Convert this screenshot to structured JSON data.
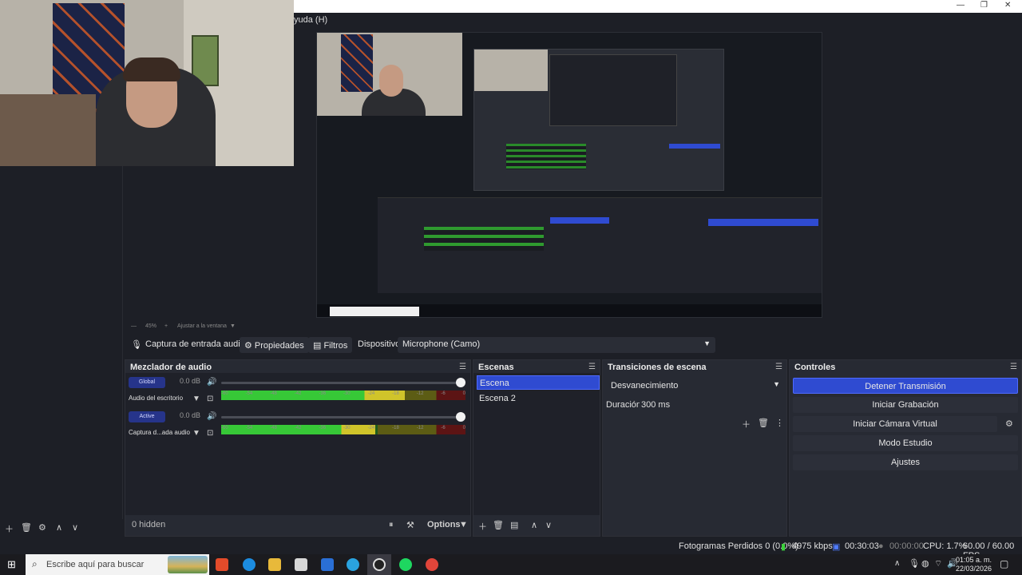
{
  "menubar": {
    "help_fragment": "yuda (H)"
  },
  "zoom": {
    "percent": "45%",
    "fit_label": "Ajustar a la ventana"
  },
  "source_toolbar": {
    "source_name": "Captura de entrada audio",
    "properties": "Propiedades",
    "filters": "Filtros",
    "device_label": "Dispositivo",
    "device_value": "Microphone (Camo)"
  },
  "mixer": {
    "title": "Mezclador de audio",
    "channels": [
      {
        "pill": "Global",
        "db": "0.0 dB",
        "name": "Audio del escritorio",
        "level": 0.75
      },
      {
        "pill": "Active",
        "db": "0.0 dB",
        "name": "Captura d...ada audio",
        "level": 0.63
      }
    ],
    "ticks": [
      "-60",
      "-54",
      "-48",
      "-42",
      "-36",
      "-30",
      "-24",
      "-18",
      "-12",
      "-6",
      "0"
    ]
  },
  "scenes": {
    "title": "Escenas",
    "items": [
      "Escena",
      "Escena 2"
    ],
    "selected": 0
  },
  "transitions": {
    "title": "Transiciones de escena",
    "selected": "Desvanecimiento",
    "duration_label": "Duración",
    "duration_value": "300 ms"
  },
  "controls": {
    "title": "Controles",
    "buttons": [
      "Detener Transmisión",
      "Iniciar Grabación",
      "Iniciar Cámara Virtual",
      "Modo Estudio",
      "Ajustes"
    ]
  },
  "sources_footer": {
    "hidden": "0 hidden",
    "options": "Options"
  },
  "status": {
    "dropped": "Fotogramas Perdidos 0 (0.0%)",
    "bitrate": "4975 kbps",
    "stream_time": "00:30:03",
    "rec_time": "00:00:00",
    "cpu": "CPU: 1.7%",
    "fps": "60.00 / 60.00 FPS"
  },
  "taskbar": {
    "search_placeholder": "Escribe aquí para buscar",
    "time": "01:05 a. m.",
    "date": "22/03/2026"
  },
  "colors": {
    "accent": "#2f4bd1",
    "panel": "#272a33",
    "bg": "#1d1f26"
  }
}
